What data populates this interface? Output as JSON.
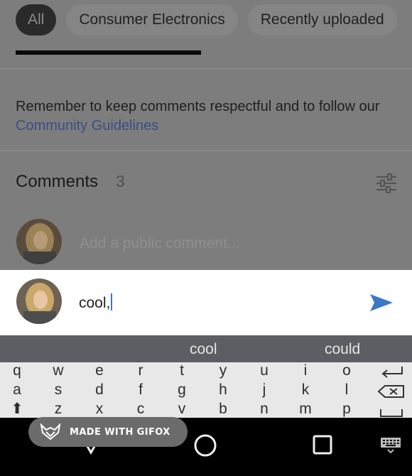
{
  "chips": [
    {
      "label": "All",
      "active": true
    },
    {
      "label": "Consumer Electronics",
      "active": false
    },
    {
      "label": "Recently uploaded",
      "active": false
    }
  ],
  "notice": {
    "text": "Remember to keep comments respectful and to follow our ",
    "link": "Community Guidelines"
  },
  "comments": {
    "title": "Comments",
    "count": "3",
    "placeholder": "Add a public comment..."
  },
  "input": {
    "value": "cool,"
  },
  "suggestions": [
    "cool",
    "could"
  ],
  "keyboard": {
    "row1": [
      "q",
      "w",
      "e",
      "r",
      "t",
      "y",
      "u",
      "i",
      "o"
    ],
    "row2": [
      "a",
      "s",
      "d",
      "f",
      "g",
      "h",
      "j",
      "k",
      "l"
    ],
    "row3": [
      "z",
      "x",
      "c",
      "v",
      "b",
      "n",
      "m",
      "p"
    ]
  },
  "watermark": {
    "text": "MADE WITH GIFOX"
  },
  "icons": {
    "sort": "tune-sliders-icon",
    "send": "send-arrow-icon",
    "backspace": "backspace-icon",
    "enter": "enter-icon",
    "space": "space-icon",
    "nav_back": "back-triangle-icon",
    "nav_home": "home-circle-icon",
    "nav_recents": "recents-square-icon",
    "nav_keyboard": "keyboard-icon"
  },
  "colors": {
    "accent": "#3b78c8",
    "link": "#3a4f85",
    "suggestion_bar": "#5b5e63",
    "keyboard_bg": "#e8e8e8"
  }
}
